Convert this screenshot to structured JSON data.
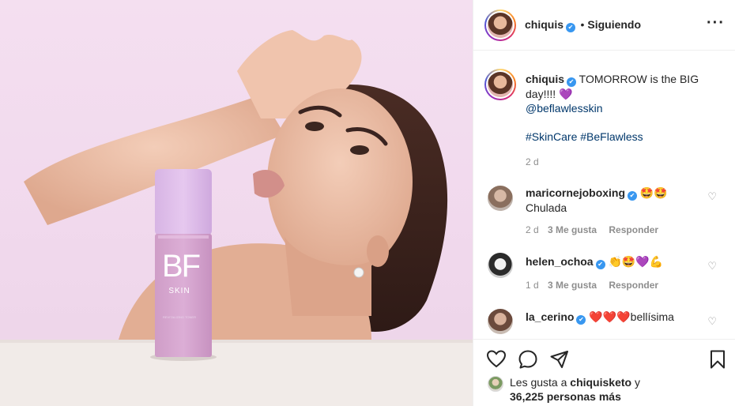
{
  "post": {
    "author": "chiquis",
    "follow_state": "Siguiendo",
    "more_icon": "···"
  },
  "image": {
    "brand_logo": "BF",
    "brand_sub": "SKIN",
    "bottle_fine_print": "REVITALIZING TONER"
  },
  "caption": {
    "username": "chiquis",
    "text": "TOMORROW is the BIG day!!!! 💜",
    "mention": "@beflawlesskin",
    "hashtags": "#SkinCare #BeFlawless",
    "time": "2 d"
  },
  "comments": [
    {
      "username": "maricornejoboxing",
      "text": "🤩🤩",
      "text2": "Chulada",
      "time": "2 d",
      "likes": "3 Me gusta",
      "reply": "Responder"
    },
    {
      "username": "helen_ochoa",
      "text": "👏🤩💜💪",
      "time": "1 d",
      "likes": "3 Me gusta",
      "reply": "Responder"
    },
    {
      "username": "la_cerino",
      "text": "❤️❤️❤️bellísima"
    }
  ],
  "likes": {
    "prefix": "Les gusta a",
    "user": "chiquisketo",
    "suffix": "y",
    "count": "36,225 personas más"
  },
  "colors": {
    "verified": "#3897f0",
    "link": "#00376b",
    "muted": "#8e8e8e"
  }
}
